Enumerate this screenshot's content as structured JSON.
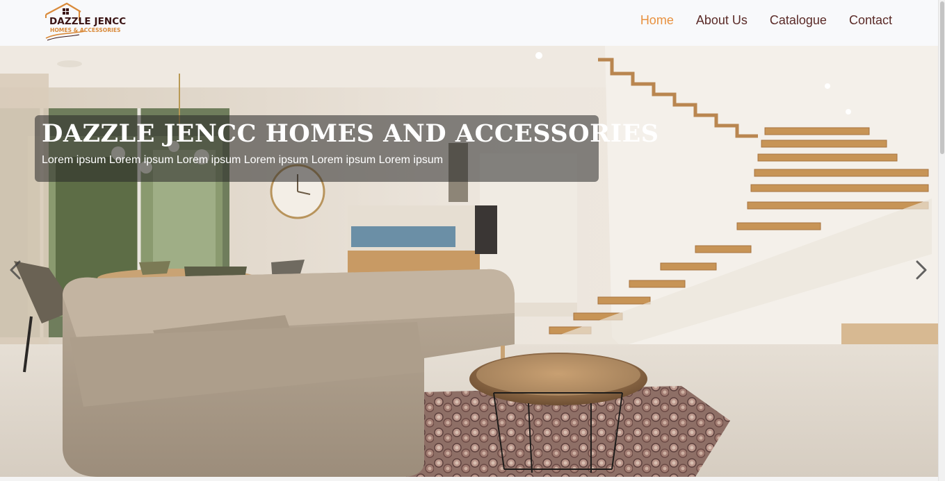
{
  "brand": {
    "name": "DAZZLE JENCC",
    "tagline": "HOMES & ACCESSORIES",
    "logo_icon": "house-roof-icon",
    "colors": {
      "primary": "#3a1414",
      "accent": "#d98a3a"
    }
  },
  "nav": {
    "items": [
      {
        "label": "Home",
        "active": true
      },
      {
        "label": "About Us",
        "active": false
      },
      {
        "label": "Catalogue",
        "active": false
      },
      {
        "label": "Contact",
        "active": false
      }
    ],
    "colors": {
      "active": "#e8913f",
      "default": "#5a2a27"
    }
  },
  "hero": {
    "title": "DAZZLE JENCC HOMES AND ACCESSORIES",
    "subtitle": "Lorem ipsum Lorem ipsum Lorem ipsum Lorem ipsum Lorem ipsum Lorem ipsum",
    "prev_icon": "chevron-left-icon",
    "next_icon": "chevron-right-icon"
  }
}
